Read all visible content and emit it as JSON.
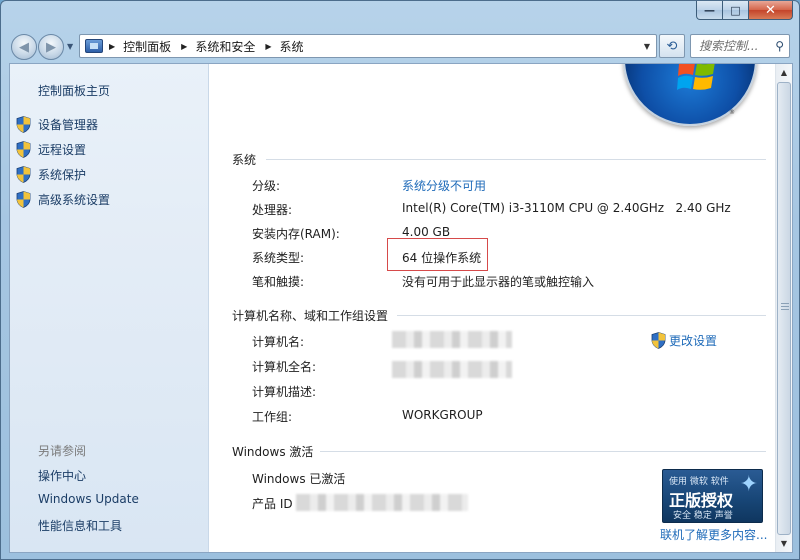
{
  "window": {
    "controls": {
      "minimize": "—",
      "maximize": "□",
      "close": "✕"
    }
  },
  "nav": {
    "breadcrumbs": [
      "控制面板",
      "系统和安全",
      "系统"
    ],
    "search": {
      "placeholder": "搜索控制..."
    },
    "icons": [
      "back-arrow-icon",
      "forward-arrow-icon",
      "control-panel-icon",
      "refresh-icon",
      "search-icon"
    ]
  },
  "sidebar": {
    "home": "控制面板主页",
    "tasks": [
      {
        "label": "设备管理器",
        "icon": "uac-shield-icon"
      },
      {
        "label": "远程设置",
        "icon": "uac-shield-icon"
      },
      {
        "label": "系统保护",
        "icon": "uac-shield-icon"
      },
      {
        "label": "高级系统设置",
        "icon": "uac-shield-icon"
      }
    ],
    "see_also": {
      "title": "另请参阅",
      "links": [
        "操作中心",
        "Windows Update",
        "性能信息和工具"
      ]
    }
  },
  "system": {
    "title": "系统",
    "rows": [
      {
        "label": "分级:",
        "value": "系统分级不可用",
        "is_link": true
      },
      {
        "label": "处理器:",
        "value": "Intel(R) Core(TM) i3-3110M CPU @ 2.40GHz   2.40 GHz"
      },
      {
        "label": "安装内存(RAM):",
        "value": "4.00 GB"
      },
      {
        "label": "系统类型:",
        "value": "64 位操作系统",
        "highlighted": true
      },
      {
        "label": "笔和触摸:",
        "value": "没有可用于此显示器的笔或触控输入"
      }
    ]
  },
  "computer": {
    "title": "计算机名称、域和工作组设置",
    "rows": [
      {
        "label": "计算机名:",
        "value": ""
      },
      {
        "label": "计算机全名:",
        "value": ""
      },
      {
        "label": "计算机描述:",
        "value": ""
      },
      {
        "label": "工作组:",
        "value": "WORKGROUP"
      }
    ],
    "change_settings": "更改设置"
  },
  "activation": {
    "title": "Windows 激活",
    "status": "Windows 已激活",
    "product_id_label": "产品 ID",
    "badge": {
      "top": "使用 微软 软件",
      "main": "正版授权",
      "bottom": "安全 稳定 声誉"
    },
    "more_link": "联机了解更多内容..."
  },
  "colors": {
    "link": "#1f6bb9",
    "highlight_border": "#d64a4a",
    "sidebar_bg": "#e3ecf6"
  }
}
